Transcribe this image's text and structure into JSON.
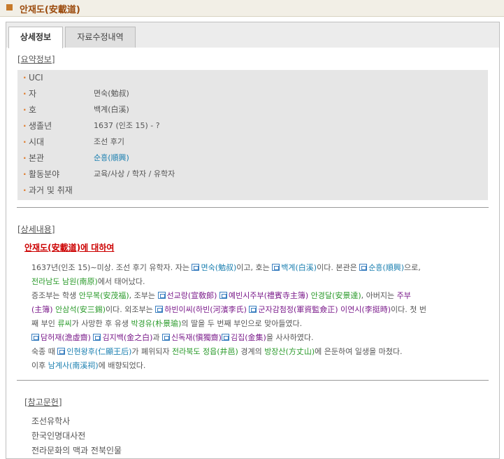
{
  "header": {
    "title": "안재도(安載道)"
  },
  "tabs": [
    {
      "label": "상세정보"
    },
    {
      "label": "자료수정내역"
    }
  ],
  "summary": {
    "heading": "[요약정보]",
    "rows": [
      {
        "key": "UCI",
        "value": ""
      },
      {
        "key": "자",
        "value": "면숙(勉叔)"
      },
      {
        "key": "호",
        "value": "백계(白溪)"
      },
      {
        "key": "생졸년",
        "value": "1637 (인조 15) - ?"
      },
      {
        "key": "시대",
        "value": "조선 후기"
      },
      {
        "key": "본관",
        "value": "순흥(順興)"
      },
      {
        "key": "활동분야",
        "value": "교육/사상 / 학자 / 유학자"
      },
      {
        "key": "과거 및 취재",
        "value": ""
      }
    ]
  },
  "detail": {
    "heading": "[상세내용]",
    "about": "안재도(安載道)에 대하여",
    "l1a": "1637년(인조 15)∼미상. 조선 후기 유학자. 자는 ",
    "l1b": "면숙(勉叔)",
    "l1c": "이고, 호는 ",
    "l1d": "백계(白溪)",
    "l1e": "이다. 본관은 ",
    "l1f": "순흥(順興)",
    "l1g": "으로,",
    "l2a": "전라남도 남원(南原)",
    "l2b": "에서 태어났다.",
    "l3a": "증조부는 학생 ",
    "l3b": "안무복(安茂福)",
    "l3c": ", 조부는 ",
    "l3d": "선교랑(宣敎郞)",
    "l3e": "예빈시주부(禮賓寺主簿)",
    "l3f": " 안경달(安景達)",
    "l3g": ", 아버지는     ",
    "l3h": "주부",
    "l4a": "(主簿)",
    "l4b": " 안삼석(安三錫)",
    "l4c": "이다. 외조부는 ",
    "l4d": "하빈이씨(하빈(河濱李氏)",
    "l4e": "군자감첨정(軍資監僉正)",
    "l4f": " 이연시(李挺時)",
    "l4g": "이다. 첫 번",
    "l5a": "째 부인 ",
    "l5b": "류씨",
    "l5c": "가 사망한 후 유생 ",
    "l5d": "박경유(朴景瑜)",
    "l5e": "의 딸을 두 번째 부인으로 맞아들였다.",
    "l6a": "담허재(澹虛齋)",
    "l6b": "김지백(金之白)",
    "l6c": "과 ",
    "l6d": "신독재(愼獨齋)",
    "l6e": "김집(金集)",
    "l6f": "을 사사하였다.",
    "l7a": "숙종 때 ",
    "l7b": "인현왕후(仁顯王后)",
    "l7c": "가 폐위되자 ",
    "l7d": "전라북도 정읍(井邑)",
    "l7e": " 경계의 ",
    "l7f": "방장산(方丈山)",
    "l7g": "에 은둔하여 일생을 마쳤다.",
    "l8a": "이후 ",
    "l8b": "남계사(南溪祠)",
    "l8c": "에 배향되었다."
  },
  "references": {
    "heading": "[참고문헌]",
    "items": [
      "조선유학사",
      "한국인명대사전",
      "전라문화의 맥과 전북인물"
    ]
  },
  "colors": {
    "accent": "#c77a2a",
    "title": "#9b4a0c",
    "link": "#1a7fb0",
    "place": "#2a9a2a",
    "office": "#7a1a8a",
    "about": "#cc0000"
  }
}
